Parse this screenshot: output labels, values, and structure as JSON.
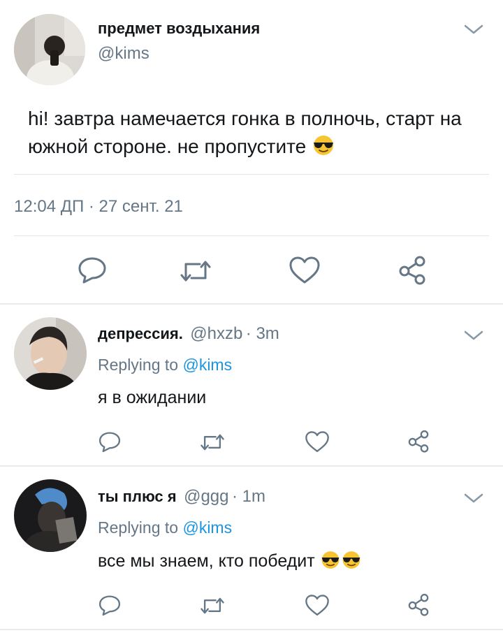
{
  "main_tweet": {
    "display_name": "предмет воздыхания",
    "handle": "@kims",
    "text": "hi! завтра намечается гонка в полночь, старт на южной стороне. не пропустите",
    "timestamp": "12:04 ДП · 27 сент. 21",
    "emoji": "sunglasses-face"
  },
  "replies": [
    {
      "display_name": "депрессия.",
      "handle": "@hxzb",
      "time": "· 3m",
      "replying_prefix": "Replying to ",
      "replying_to": "@kims",
      "text": "я в ожидании"
    },
    {
      "display_name": "ты плюс я",
      "handle": "@ggg",
      "time": "· 1m",
      "replying_prefix": "Replying to ",
      "replying_to": "@kims",
      "text": "все мы знаем, кто победит",
      "emoji_count": 2
    }
  ],
  "actions": [
    "reply-icon",
    "retweet-icon",
    "like-icon",
    "share-icon"
  ],
  "colors": {
    "text": "#14171a",
    "muted": "#657786",
    "link": "#1b95e0",
    "divider": "#e1e8ed"
  }
}
